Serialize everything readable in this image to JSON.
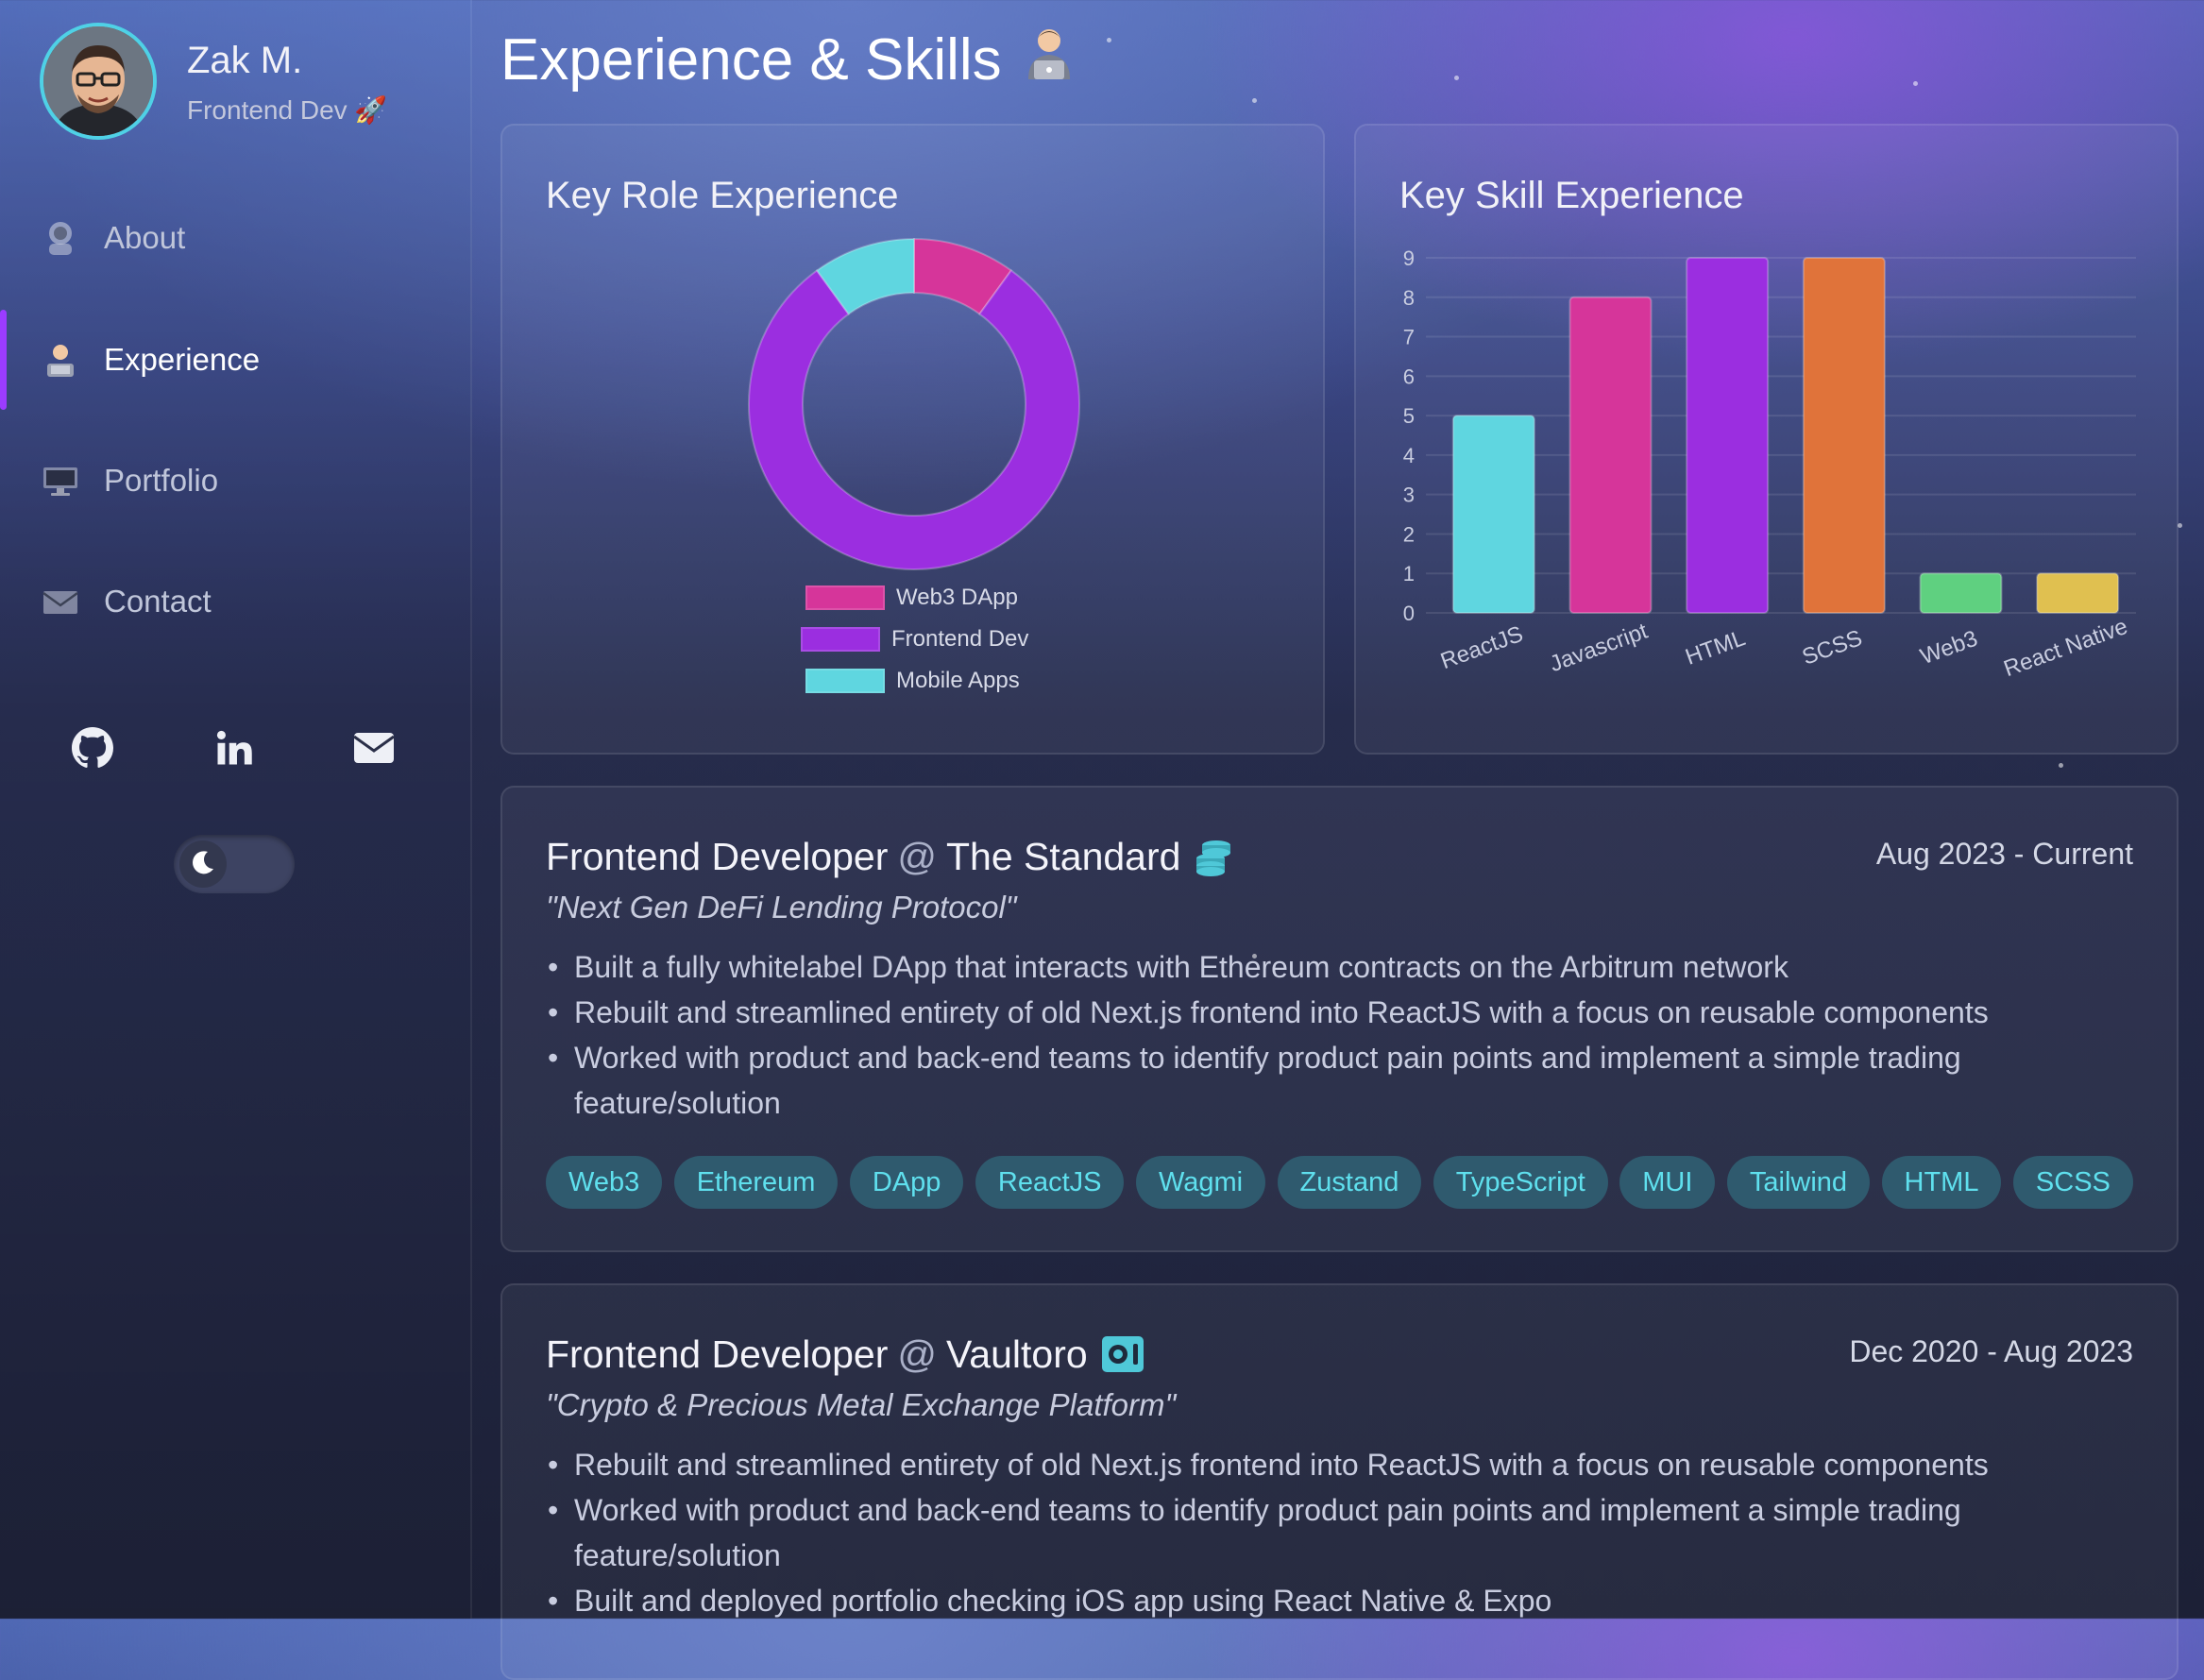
{
  "profile": {
    "name": "Zak M.",
    "role": "Frontend Dev 🚀"
  },
  "nav": {
    "items": [
      {
        "label": "About",
        "icon": "astronaut-icon"
      },
      {
        "label": "Experience",
        "icon": "technologist-icon",
        "active": true
      },
      {
        "label": "Portfolio",
        "icon": "monitor-icon"
      },
      {
        "label": "Contact",
        "icon": "envelope-icon"
      }
    ]
  },
  "social": [
    "github-icon",
    "linkedin-icon",
    "mail-icon"
  ],
  "theme_toggle": {
    "mode": "dark",
    "icon": "moon-icon"
  },
  "page": {
    "title": "Experience & Skills",
    "title_icon": "technologist-icon"
  },
  "colors": {
    "accent": "#9b3cff",
    "tag_bg": "#2f5a6e",
    "tag_text": "#5fe0ee"
  },
  "role_chart_title": "Key Role Experience",
  "skill_chart_title": "Key Skill Experience",
  "chart_data": [
    {
      "type": "pie",
      "variant": "doughnut",
      "title": "Key Role Experience",
      "legend": "bottom",
      "categories": [
        "Web3 DApp",
        "Frontend Dev",
        "Mobile Apps"
      ],
      "values": [
        1,
        8,
        1
      ],
      "colors": [
        "#d6359a",
        "#9b2ee0",
        "#5fd6e0"
      ]
    },
    {
      "type": "bar",
      "title": "Key Skill Experience",
      "categories": [
        "ReactJS",
        "Javascript",
        "HTML",
        "SCSS",
        "Web3",
        "React Native"
      ],
      "values": [
        5,
        8,
        9,
        9,
        1,
        1
      ],
      "colors": [
        "#5fd6e0",
        "#d6359a",
        "#9b2ee0",
        "#e0733a",
        "#5fd080",
        "#e0c050"
      ],
      "ylim": [
        0,
        9
      ],
      "yticks": [
        0,
        1,
        2,
        3,
        4,
        5,
        6,
        7,
        8,
        9
      ],
      "grid": true
    }
  ],
  "experiences": [
    {
      "role": "Frontend Developer",
      "at": "@",
      "company": "The Standard",
      "icon": "coin-stack-icon",
      "date": "Aug 2023 - Current",
      "tagline": "\"Next Gen DeFi Lending Protocol\"",
      "bullets": [
        "Built a fully whitelabel DApp that interacts with Ethereum contracts on the Arbitrum network",
        "Rebuilt and streamlined entirety of old Next.js frontend into ReactJS with a focus on reusable components",
        "Worked with product and back-end teams to identify product pain points and implement a simple trading feature/solution"
      ],
      "tags": [
        "Web3",
        "Ethereum",
        "DApp",
        "ReactJS",
        "Wagmi",
        "Zustand",
        "TypeScript",
        "MUI",
        "Tailwind",
        "HTML",
        "SCSS"
      ]
    },
    {
      "role": "Frontend Developer",
      "at": "@",
      "company": "Vaultoro",
      "icon": "vault-icon",
      "date": "Dec 2020 - Aug 2023",
      "tagline": "\"Crypto & Precious Metal Exchange Platform\"",
      "bullets": [
        "Rebuilt and streamlined entirety of old Next.js frontend into ReactJS with a focus on reusable components",
        "Worked with product and back-end teams to identify product pain points and implement a simple trading feature/solution",
        "Built and deployed portfolio checking iOS app using React Native & Expo"
      ]
    }
  ]
}
